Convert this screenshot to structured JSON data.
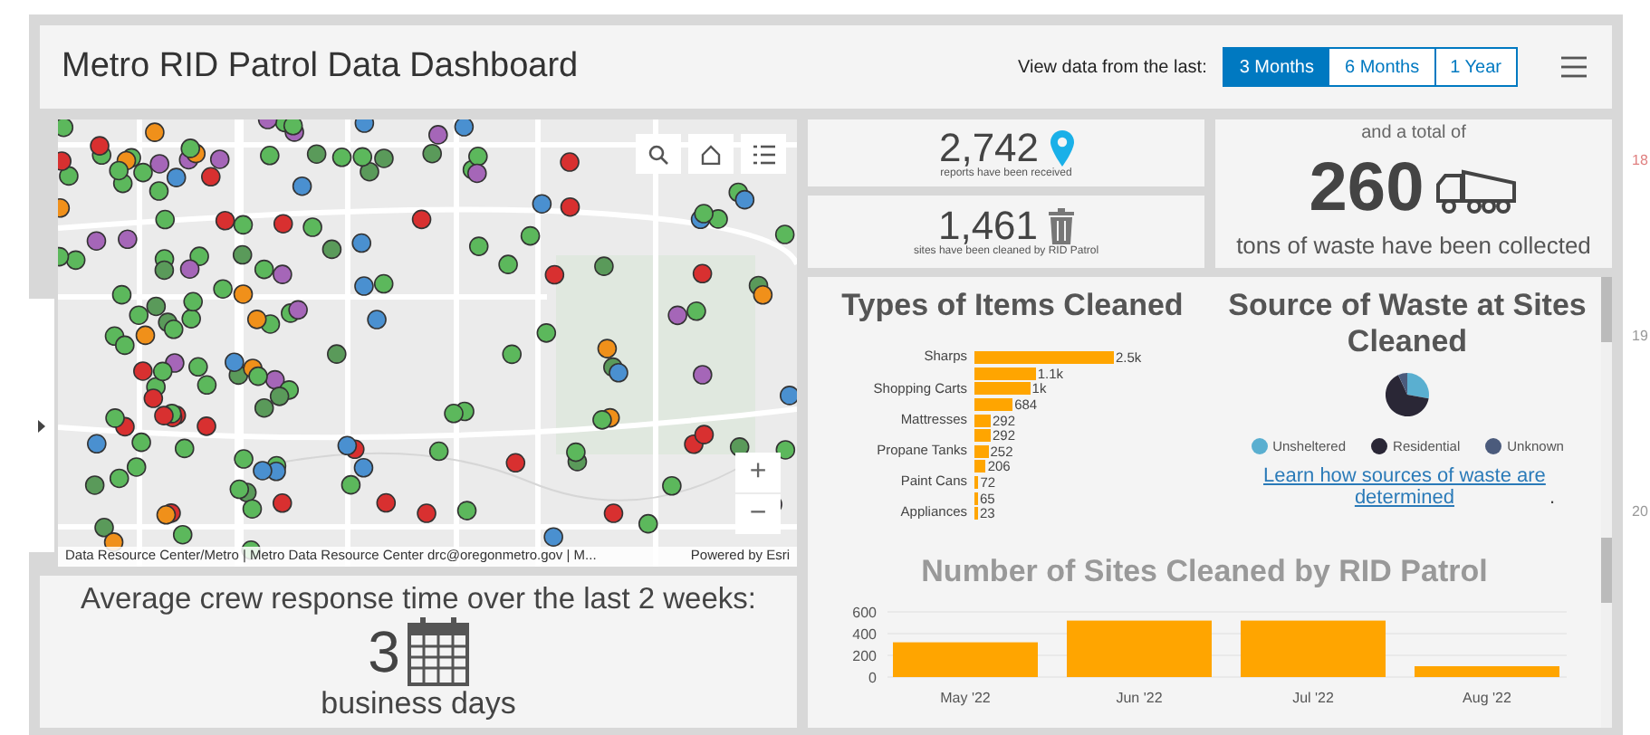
{
  "header": {
    "title": "Metro RID Patrol Data Dashboard",
    "range_label": "View data from the last:",
    "ranges": [
      {
        "label": "3 Months",
        "selected": true
      },
      {
        "label": "6 Months",
        "selected": false
      },
      {
        "label": "1 Year",
        "selected": false
      }
    ]
  },
  "map": {
    "attribution": "Data Resource Center/Metro | Metro Data Resource Center drc@oregonmetro.gov | M...",
    "powered_by": "Powered by Esri",
    "zoom_in": "+",
    "zoom_out": "−"
  },
  "response": {
    "heading": "Average crew response time over the last 2 weeks:",
    "value": "3",
    "unit": "business days"
  },
  "stats": [
    {
      "value": "2,742",
      "caption": "reports have been received"
    },
    {
      "value": "1,461",
      "caption": "sites have been cleaned by RID Patrol"
    }
  ],
  "total": {
    "intro": "and a total of",
    "value": "260",
    "caption": "tons of waste have been collected"
  },
  "items_chart": {
    "title": "Types of Items Cleaned",
    "chart_data": {
      "type": "bar",
      "orientation": "horizontal",
      "categories": [
        "Sharps",
        null,
        "Shopping Carts",
        null,
        "Mattresses",
        null,
        "Propane Tanks",
        null,
        "Paint Cans",
        null,
        "Appliances"
      ],
      "values": [
        2500,
        1100,
        1000,
        684,
        292,
        292,
        252,
        206,
        72,
        65,
        23
      ],
      "value_labels": [
        "2.5k",
        "1.1k",
        "1k",
        "684",
        "292",
        "292",
        "252",
        "206",
        "72",
        "65",
        "23"
      ],
      "color": "#ffa500"
    }
  },
  "source": {
    "title": "Source of Waste at Sites Cleaned",
    "legend": [
      {
        "label": "Unsheltered",
        "color": "#5aafd0"
      },
      {
        "label": "Residential",
        "color": "#2a2736"
      },
      {
        "label": "Unknown",
        "color": "#4b5b7c"
      }
    ],
    "link": "Learn how sources of waste are determined",
    "after_link": "."
  },
  "sites_chart": {
    "title": "Number of Sites Cleaned by RID Patrol",
    "chart_data": {
      "type": "bar",
      "categories": [
        "May '22",
        "Jun '22",
        "Jul '22",
        "Aug '22"
      ],
      "values": [
        320,
        520,
        520,
        100
      ],
      "ylim": [
        0,
        600
      ],
      "yticks": [
        0,
        200,
        400,
        600
      ],
      "color": "#ffa500"
    }
  },
  "margin_labels": [
    {
      "text": "18",
      "color": "#e08080"
    },
    {
      "text": "19",
      "color": "#999999"
    },
    {
      "text": "20",
      "color": "#999999"
    }
  ]
}
